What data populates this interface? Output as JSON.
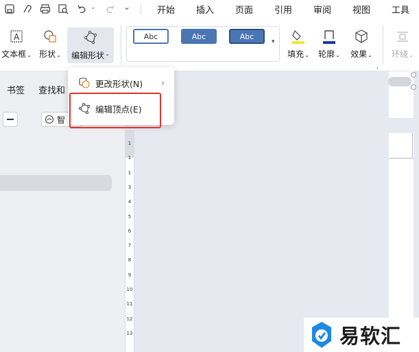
{
  "menu": {
    "tabs": [
      "开始",
      "插入",
      "页面",
      "引用",
      "审阅",
      "视图",
      "工具"
    ]
  },
  "ribbon": {
    "textbox_label": "文本框",
    "shape_label": "形状",
    "edit_shape_label": "编辑形状",
    "styles": [
      "Abc",
      "Abc",
      "Abc"
    ],
    "fill_label": "填充",
    "outline_label": "轮廓",
    "effect_label": "效果",
    "wrap_label": "环绕"
  },
  "left_panel": {
    "tabs": [
      "书签",
      "查找和"
    ],
    "smart_chip": "智"
  },
  "ruler": {
    "ticks": [
      "1",
      "1",
      "1",
      "3",
      "4",
      "5",
      "6",
      "7",
      "8",
      "9",
      "10",
      "11",
      "12",
      "13"
    ]
  },
  "dropdown": {
    "items": [
      {
        "label": "更改形状(N)",
        "has_submenu": true
      },
      {
        "label": "编辑顶点(E)",
        "has_submenu": false
      }
    ]
  },
  "watermark": {
    "text": "易软汇"
  },
  "colors": {
    "highlight": "#e0352b",
    "style_accent": "#4a76b3",
    "fill_bar": "#f5e43a",
    "outline_bar": "#1f3a9e"
  }
}
